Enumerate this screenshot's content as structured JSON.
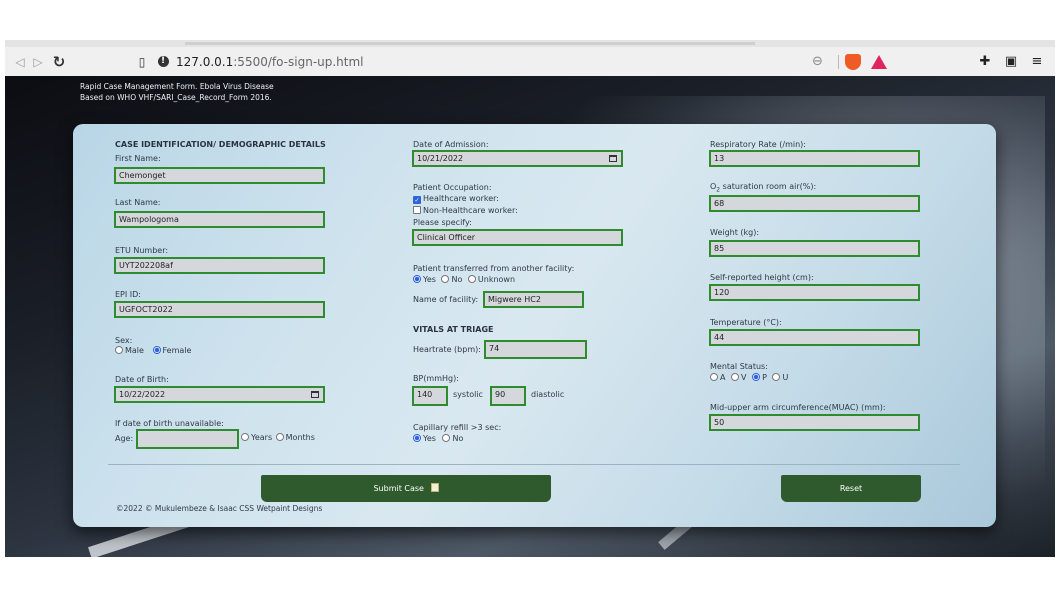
{
  "browser": {
    "url_host": "127.0.0.1",
    "url_path": ":5500/fo-sign-up.html"
  },
  "header": {
    "line1": "Rapid Case Management Form. Ebola Virus Disease",
    "line2": "Based on WHO VHF/SARI_Case_Record_Form 2016."
  },
  "col1": {
    "section_title": "CASE IDENTIFICATION/ DEMOGRAPHIC DETAILS",
    "first_name_label": "First Name:",
    "first_name": "Chemonget",
    "last_name_label": "Last Name:",
    "last_name": "Wampologoma",
    "etu_label": "ETU Number:",
    "etu": "UYT202208af",
    "epi_label": "EPI ID:",
    "epi": "UGFOCT2022",
    "sex_label": "Sex:",
    "sex_options": [
      "Male",
      "Female"
    ],
    "sex_selected": "Female",
    "dob_label": "Date of Birth:",
    "dob": "10/22/2022",
    "dob_unavailable_label": "If date of birth unavailable:",
    "age_label": "Age:",
    "age": "",
    "age_unit_options": [
      "Years",
      "Months"
    ]
  },
  "col2": {
    "admission_label": "Date of Admission:",
    "admission": "10/21/2022",
    "occupation_label": "Patient Occupation:",
    "hcw_label": "Healthcare worker:",
    "hcw_checked": true,
    "non_hcw_label": "Non-Healthcare worker:",
    "non_hcw_checked": false,
    "specify_label": "Please specify:",
    "specify": "Clinical Officer",
    "transferred_label": "Patient transferred from another facility:",
    "transferred_options": [
      "Yes",
      "No",
      "Unknown"
    ],
    "transferred_selected": "Yes",
    "facility_label": "Name of facility:",
    "facility": "Migwere HC2",
    "vitals_title": "VITALS AT TRIAGE",
    "heartrate_label": "Heartrate (bpm):",
    "heartrate": "74",
    "bp_label": "BP(mmHg):",
    "systolic": "140",
    "systolic_label": "systolic",
    "diastolic": "90",
    "diastolic_label": "diastolic",
    "cap_refill_label": "Capillary refill >3 sec:",
    "cap_refill_options": [
      "Yes",
      "No"
    ],
    "cap_refill_selected": "Yes"
  },
  "col3": {
    "resp_label": "Respiratory Rate (/min):",
    "resp": "13",
    "o2_label_pre": "O",
    "o2_label_sub": "2",
    "o2_label_post": " saturation room air(%):",
    "o2": "68",
    "weight_label": "Weight (kg):",
    "weight": "85",
    "height_label": "Self-reported height (cm):",
    "height": "120",
    "temp_label": "Temperature (°C):",
    "temp": "44",
    "mental_label": "Mental Status:",
    "mental_options": [
      "A",
      "V",
      "P",
      "U"
    ],
    "mental_selected": "P",
    "muac_label": "Mid-upper arm circumference(MUAC) (mm):",
    "muac": "50"
  },
  "actions": {
    "submit_label": "Submit Case",
    "submit_icon": "memo-icon",
    "reset_label": "Reset"
  },
  "footer": {
    "text": "©2022 © Mukulembeze & Isaac CSS Wetpaint Designs"
  },
  "colors": {
    "field_border": "#2e8b2e",
    "button_bg": "#2e5a2e",
    "radio_on": "#2f63d8"
  }
}
